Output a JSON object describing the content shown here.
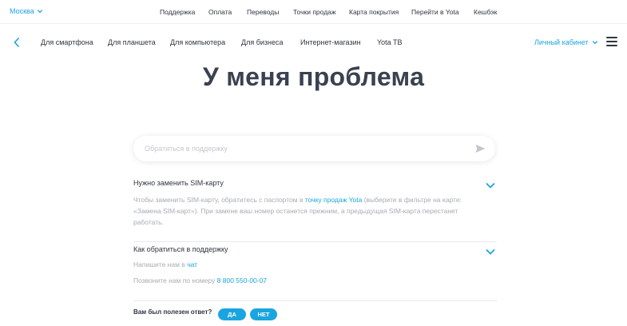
{
  "topbar": {
    "city": "Москва",
    "links": [
      "Поддержка",
      "Оплата",
      "Переводы",
      "Точки продаж",
      "Карта покрытия",
      "Перейти в Yota",
      "Кешбэк"
    ]
  },
  "navbar": {
    "links": [
      "Для смартфона",
      "Для планшета",
      "Для компьютера",
      "Для бизнеса",
      "Интернет-магазин",
      "Yota TB"
    ],
    "cabinet": "Личный кабинет"
  },
  "page": {
    "title": "У меня проблема"
  },
  "search": {
    "placeholder": "Обратиться в поддержку"
  },
  "faq": {
    "q1": {
      "question": "Нужно заменить SIM-карту",
      "answer_before": "Чтобы заменить SIM-карту, обратитесь с паспортом в ",
      "answer_link": "точку продаж Yota",
      "answer_after": " (выберите в фильтре на карте: «Замена SIM-карт»). При замене ваш номер останется прежним, а предыдущая SIM-карта перестанет работать."
    },
    "q2": {
      "question": "Как обратиться в поддержку",
      "chat_prefix": "Напишите нам в ",
      "chat_link": "чат",
      "phone_prefix": "Позвоните нам по номеру ",
      "phone_link": "8 800 550-00-07"
    }
  },
  "feedback": {
    "label": "Вам был полезен ответ?",
    "yes": "ДА",
    "no": "НЕТ"
  },
  "colors": {
    "accent": "#1aa5e0",
    "text": "#2f3540",
    "muted": "#a7acb3"
  },
  "icons": {
    "city_dropdown": "chevron-down-icon",
    "back": "chevron-left-icon",
    "send": "send-icon",
    "menu": "hamburger-icon",
    "expand": "chevron-down-icon"
  }
}
